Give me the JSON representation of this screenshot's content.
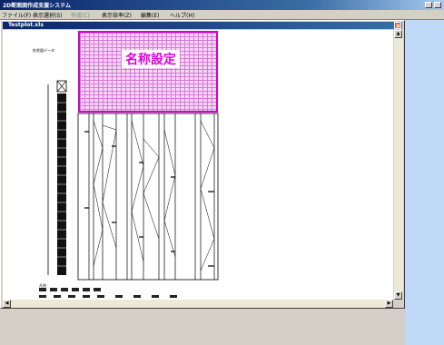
{
  "app": {
    "title": "2D断面図作成支援システム",
    "accent": "#0a246a"
  },
  "menu": {
    "items": [
      {
        "label": "ファイル(F)",
        "enabled": true
      },
      {
        "label": "表示選択(S)",
        "enabled": true
      },
      {
        "label": "作成(C)",
        "enabled": false
      },
      {
        "label": "表示倍率(Z)",
        "enabled": true
      },
      {
        "label": "編集(E)",
        "enabled": true
      },
      {
        "label": "ヘルプ(H)",
        "enabled": true
      }
    ]
  },
  "document": {
    "title": "Testplot.xls",
    "data_label": "柱状図データ",
    "name_box_label": "名称設定",
    "highlight_color": "#d000d0",
    "legend_row_1": [
      "砂礫",
      "粘土",
      "シルト",
      "砂",
      "腐植土",
      "礫"
    ],
    "legend_row_2": [
      "埋土",
      "粘土",
      "砂質土",
      "砂",
      "N値",
      "粘性土",
      "砂質シルト",
      "礫混じり",
      "盛土"
    ],
    "legend_title": "凡例"
  },
  "icons": {
    "close": "close-icon",
    "scroll_up": "arrow-up-icon",
    "scroll_down": "arrow-down-icon",
    "scroll_left": "arrow-left-icon",
    "scroll_right": "arrow-right-icon"
  }
}
